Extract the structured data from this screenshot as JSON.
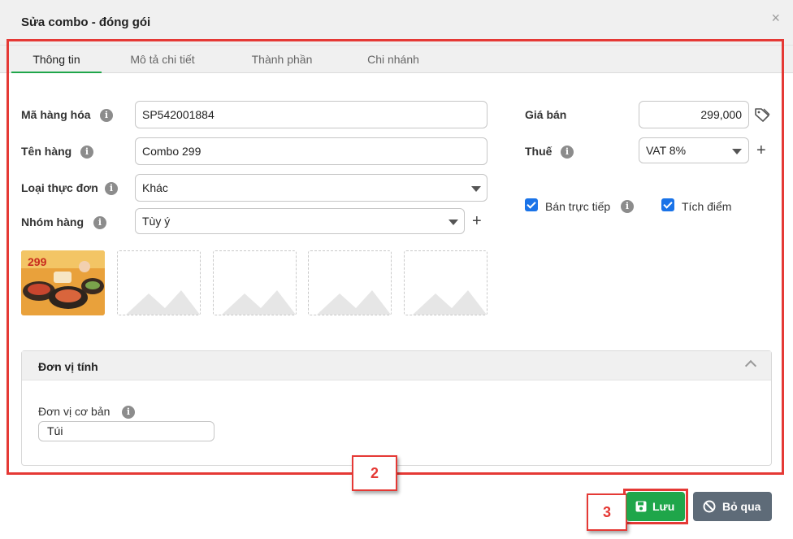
{
  "dialog": {
    "title": "Sửa combo - đóng gói",
    "close_glyph": "×"
  },
  "tabs": [
    {
      "label": "Thông tin",
      "active": true
    },
    {
      "label": "Mô tả chi tiết",
      "active": false
    },
    {
      "label": "Thành phần",
      "active": false
    },
    {
      "label": "Chi nhánh",
      "active": false
    }
  ],
  "form": {
    "ma_hang_hoa": {
      "label": "Mã hàng hóa",
      "value": "SP542001884"
    },
    "ten_hang": {
      "label": "Tên hàng",
      "value": "Combo 299"
    },
    "loai_thuc_don": {
      "label": "Loại thực đơn",
      "value": "Khác"
    },
    "nhom_hang": {
      "label": "Nhóm hàng",
      "value": "Tùy ý"
    },
    "gia_ban": {
      "label": "Giá bán",
      "value": "299,000"
    },
    "thue": {
      "label": "Thuế",
      "value": "VAT 8%"
    },
    "ban_truc_tiep": {
      "label": "Bán trực tiếp",
      "checked": true
    },
    "tich_diem": {
      "label": "Tích điểm",
      "checked": true
    }
  },
  "images": {
    "thumbnail_text": "299",
    "empty_slots": 4
  },
  "unit_section": {
    "title": "Đơn vị tính",
    "base_unit_label": "Đơn vị cơ bản",
    "base_unit_value": "Túi"
  },
  "callouts": {
    "content_box": "2",
    "save_box": "3"
  },
  "buttons": {
    "save": "Lưu",
    "cancel": "Bỏ qua"
  },
  "colors": {
    "primary_green": "#1fa64a",
    "cancel_gray": "#5e6b78",
    "annotation_red": "#e53935",
    "checkbox_blue": "#1a73e8"
  }
}
